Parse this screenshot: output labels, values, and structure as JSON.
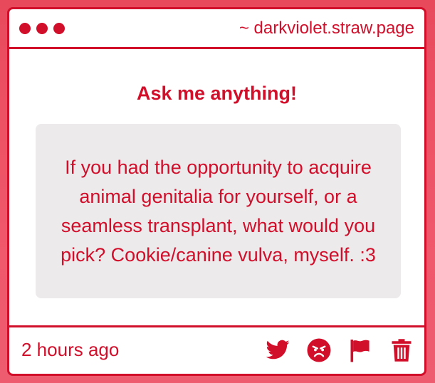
{
  "window": {
    "site": "~ darkviolet.straw.page"
  },
  "main": {
    "heading": "Ask me anything!",
    "question": "If you had the opportunity to acquire animal genitalia for yourself, or a seamless transplant, what would you pick? Cookie/canine vulva, myself. :3"
  },
  "footer": {
    "timestamp": "2 hours ago",
    "actions": [
      "twitter-icon",
      "angry-face-icon",
      "flag-icon",
      "trash-icon"
    ]
  },
  "colors": {
    "accent": "#d10f2b",
    "background": "#ee5c70",
    "question_bg": "#eceaeb"
  }
}
